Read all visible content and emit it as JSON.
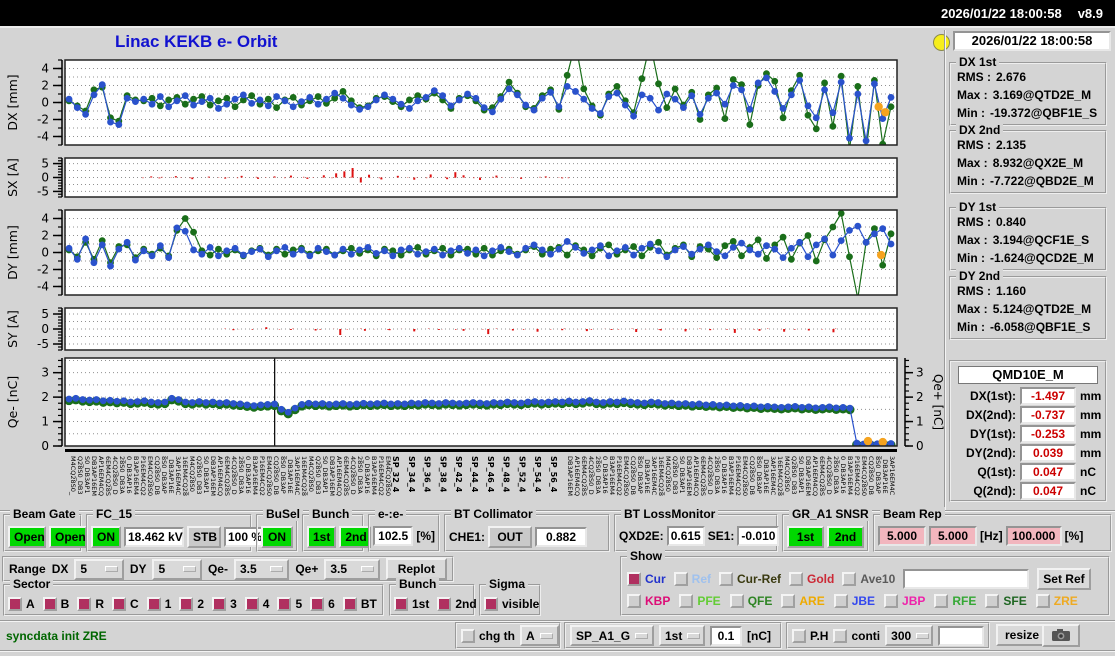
{
  "topbar": {
    "datetime": "2026/01/22 18:00:58",
    "version": "v8.9"
  },
  "header": {
    "title": "Linac KEKB e- Orbit",
    "clock": "2026/01/22 18:00:58"
  },
  "stats": [
    {
      "title": "DX 1st",
      "lines": [
        {
          "label": "RMS :",
          "value": "2.676"
        },
        {
          "label": "Max :",
          "value": "3.169@QTD2E_M"
        },
        {
          "label": "Min :",
          "value": "-19.372@QBF1E_S"
        }
      ]
    },
    {
      "title": "DX 2nd",
      "lines": [
        {
          "label": "RMS :",
          "value": "2.135"
        },
        {
          "label": "Max :",
          "value": "8.932@QX2E_M"
        },
        {
          "label": "Min :",
          "value": "-7.722@QBD2E_M"
        }
      ]
    },
    {
      "title": "DY 1st",
      "lines": [
        {
          "label": "RMS :",
          "value": "0.840"
        },
        {
          "label": "Max :",
          "value": "3.194@QCF1E_S"
        },
        {
          "label": "Min :",
          "value": "-1.624@QCD2E_M"
        }
      ]
    },
    {
      "title": "DY 2nd",
      "lines": [
        {
          "label": "RMS :",
          "value": "1.160"
        },
        {
          "label": "Max :",
          "value": "5.124@QTD2E_M"
        },
        {
          "label": "Min :",
          "value": "-6.058@QBF1E_S"
        }
      ]
    }
  ],
  "qmd": {
    "title": "QMD10E_M",
    "rows": [
      {
        "label": "DX(1st):",
        "value": "-1.497",
        "unit": "mm"
      },
      {
        "label": "DX(2nd):",
        "value": "-0.737",
        "unit": "mm"
      },
      {
        "label": "DY(1st):",
        "value": "-0.253",
        "unit": "mm"
      },
      {
        "label": "DY(2nd):",
        "value": "0.039",
        "unit": "mm"
      },
      {
        "label": "Q(1st):",
        "value": "0.047",
        "unit": "nC"
      },
      {
        "label": "Q(2nd):",
        "value": "0.047",
        "unit": "nC"
      }
    ]
  },
  "controls": {
    "beam_gate": {
      "title": "Beam Gate",
      "b1": "Open",
      "b2": "Open"
    },
    "fc15": {
      "title": "FC_15",
      "on": "ON",
      "kv": "18.462 kV",
      "stb": "STB",
      "pct": "100 %"
    },
    "busel": {
      "title": "BuSel",
      "on": "ON"
    },
    "bunch": {
      "title": "Bunch",
      "b1": "1st",
      "b2": "2nd"
    },
    "ee": {
      "title": "e-:e-",
      "value": "102.5",
      "unit": "[%]"
    },
    "bt_collimator": {
      "title": "BT Collimator",
      "che1_label": "CHE1:",
      "che1": "OUT",
      "value": "0.882"
    },
    "bt_loss": {
      "title": "BT LossMonitor",
      "qxd2e_label": "QXD2E:",
      "qxd2e": "0.615",
      "se1_label": "SE1:",
      "se1": "-0.010"
    },
    "gr_snsr": {
      "title": "GR_A1 SNSR",
      "b1": "1st",
      "b2": "2nd"
    },
    "beam_rep": {
      "title": "Beam Rep",
      "v1": "5.000",
      "v2": "5.000",
      "hz": "[Hz]",
      "v3": "100.000",
      "pct": "[%]"
    }
  },
  "range_row": {
    "label": "Range",
    "dx_label": "DX",
    "dx": "5",
    "dy_label": "DY",
    "dy": "5",
    "qem_label": "Qe-",
    "qem": "3.5",
    "qep_label": "Qe+",
    "qep": "3.5",
    "replot": "Replot"
  },
  "sector": {
    "title": "Sector",
    "items": [
      {
        "label": "A",
        "checked": true
      },
      {
        "label": "B",
        "checked": true
      },
      {
        "label": "R",
        "checked": true
      },
      {
        "label": "C",
        "checked": true
      },
      {
        "label": "1",
        "checked": true
      },
      {
        "label": "2",
        "checked": true
      },
      {
        "label": "3",
        "checked": true
      },
      {
        "label": "4",
        "checked": true
      },
      {
        "label": "5",
        "checked": true
      },
      {
        "label": "6",
        "checked": true
      },
      {
        "label": "BT",
        "checked": true
      }
    ]
  },
  "bunch2": {
    "title": "Bunch",
    "items": [
      {
        "label": "1st",
        "checked": true
      },
      {
        "label": "2nd",
        "checked": true
      }
    ]
  },
  "sigma": {
    "title": "Sigma",
    "item": {
      "label": "visible",
      "checked": true
    }
  },
  "show": {
    "title": "Show",
    "row1": [
      {
        "label": "Cur",
        "color": "#2233cc",
        "checked": true
      },
      {
        "label": "Ref",
        "color": "#9fc1ee",
        "checked": false
      },
      {
        "label": "Cur-Ref",
        "color": "#3a3a10",
        "checked": false
      },
      {
        "label": "Gold",
        "color": "#cc2936",
        "checked": false
      },
      {
        "label": "Ave10",
        "color": "#5a5a5a",
        "checked": false
      }
    ],
    "input_value": "",
    "set_ref": "Set Ref",
    "row2": [
      {
        "label": "KBP",
        "color": "#dd0d77",
        "checked": false
      },
      {
        "label": "PFE",
        "color": "#63cc35",
        "checked": false
      },
      {
        "label": "QFE",
        "color": "#2e8424",
        "checked": false
      },
      {
        "label": "ARE",
        "color": "#eeaa00",
        "checked": false
      },
      {
        "label": "JBE",
        "color": "#3347ee",
        "checked": false
      },
      {
        "label": "JBP",
        "color": "#ee22aa",
        "checked": false
      },
      {
        "label": "RFE",
        "color": "#35a835",
        "checked": false
      },
      {
        "label": "SFE",
        "color": "#1f6622",
        "checked": false
      },
      {
        "label": "ZRE",
        "color": "#eeaa22",
        "checked": false
      }
    ]
  },
  "statusbar": {
    "message": "syncdata init ZRE",
    "chg_th": {
      "label": "chg th",
      "checked": false
    },
    "sel_a": "A",
    "sp": "SP_A1_G",
    "first": "1st",
    "thr": "0.1",
    "nc": "[nC]",
    "ph": {
      "label": "P.H",
      "checked": false
    },
    "conti": {
      "label": "conti",
      "checked": false
    },
    "n300": "300",
    "free_input": "",
    "resize": "resize"
  },
  "colors": {
    "accent_blue": "#2a52cc",
    "accent_green": "#1a6e1a",
    "accent_orange": "#f5a31f",
    "bar_red": "#dd1111",
    "on_green": "#00d800",
    "pink": "#f2b6be",
    "check_maroon": "#b03060",
    "value_red": "#cc0000",
    "title_blue": "#1212d0"
  },
  "plots": {
    "dx": {
      "label": "DX [mm]",
      "ticks": [
        4,
        2,
        0,
        -2,
        -4
      ],
      "blue": [
        0.4,
        -0.6,
        -1.4,
        0.9,
        2.1,
        -2.3,
        -2.6,
        0.5,
        0.1,
        0.4,
        -0.2,
        0.7,
        -0.5,
        0.2,
        0.8,
        -0.3,
        0.1,
        0.5,
        -0.7,
        -0.2,
        0.4,
        0.9,
        -0.1,
        0.3,
        -0.4,
        0.7,
        0.2,
        -0.5,
        0.1,
        0.6,
        -0.2,
        0.4,
        1.1,
        0.5,
        -0.3,
        -0.8,
        -0.5,
        0.3,
        0.9,
        0.4,
        -0.2,
        -0.7,
        0.2,
        0.6,
        1.4,
        0.8,
        -0.4,
        0.3,
        1.0,
        0.5,
        -0.6,
        -1.1,
        0.4,
        1.6,
        0.9,
        -0.3,
        -0.9,
        0.5,
        1.2,
        -0.5,
        1.9,
        1.3,
        0.4,
        -0.7,
        -1.3,
        0.7,
        1.1,
        -0.3,
        -1.6,
        0.9,
        0.5,
        -0.9,
        1.0,
        0.4,
        -0.6,
        0.8,
        -1.4,
        0.5,
        1.1,
        -0.2,
        2.0,
        1.5,
        -0.8,
        2.3,
        2.9,
        1.3,
        -0.7,
        0.9,
        2.6,
        -0.4,
        -1.8,
        1.5,
        -1.2,
        2.4,
        -4.2,
        1.0,
        -4.5,
        2.2,
        -1.9,
        0.6
      ],
      "green": [
        0.2,
        -0.4,
        -1.0,
        1.5,
        1.8,
        -1.8,
        -2.2,
        0.8,
        0.3,
        0.2,
        0.5,
        -0.4,
        0.3,
        0.6,
        -0.2,
        0.4,
        0.7,
        -0.3,
        0.2,
        0.5,
        -0.5,
        0.3,
        0.8,
        -0.2,
        0.4,
        -0.6,
        0.3,
        0.6,
        -0.3,
        0.2,
        0.7,
        -0.1,
        0.5,
        1.3,
        0.2,
        -0.6,
        -0.4,
        0.5,
        0.7,
        0.1,
        -0.5,
        0.3,
        0.8,
        0.4,
        1.1,
        0.3,
        -0.7,
        0.5,
        0.8,
        0.2,
        -0.9,
        -0.6,
        0.7,
        2.4,
        1.1,
        -0.5,
        -0.7,
        0.8,
        1.5,
        -0.8,
        3.2,
        8.5,
        1.6,
        -0.4,
        -1.5,
        1.0,
        1.9,
        0.2,
        -1.2,
        2.8,
        8.8,
        2.2,
        -0.6,
        1.6,
        -0.3,
        1.2,
        -2.0,
        0.9,
        1.7,
        -1.9,
        2.7,
        2.1,
        -2.6,
        2.0,
        3.4,
        2.5,
        -1.8,
        1.4,
        3.2,
        -1.5,
        -3.1,
        2.3,
        -2.8,
        3.1,
        -5.5,
        1.9,
        -5.8,
        2.6,
        -4.9,
        -0.5
      ],
      "orange": [
        [
          0.985,
          -0.5
        ],
        [
          0.993,
          -1.15
        ]
      ]
    },
    "sx": {
      "label": "SX [A]",
      "ticks": [
        5,
        0,
        -5
      ],
      "bars": [
        [
          0.1,
          0.4
        ],
        [
          0.11,
          -0.3
        ],
        [
          0.13,
          0.5
        ],
        [
          0.15,
          -0.6
        ],
        [
          0.17,
          0.3
        ],
        [
          0.19,
          -0.4
        ],
        [
          0.21,
          0.6
        ],
        [
          0.23,
          -0.5
        ],
        [
          0.25,
          0.4
        ],
        [
          0.27,
          0.7
        ],
        [
          0.29,
          -0.5
        ],
        [
          0.31,
          0.8
        ],
        [
          0.325,
          1.5
        ],
        [
          0.335,
          2.2
        ],
        [
          0.345,
          3.4
        ],
        [
          0.355,
          -1.8
        ],
        [
          0.365,
          1.0
        ],
        [
          0.38,
          -0.7
        ],
        [
          0.4,
          0.6
        ],
        [
          0.42,
          -0.8
        ],
        [
          0.44,
          1.1
        ],
        [
          0.46,
          -0.6
        ],
        [
          0.47,
          1.9
        ],
        [
          0.48,
          0.8
        ],
        [
          0.5,
          -0.9
        ],
        [
          0.52,
          0.7
        ],
        [
          0.55,
          -0.5
        ],
        [
          0.58,
          0.4
        ],
        [
          0.6,
          -0.3
        ]
      ]
    },
    "dy": {
      "label": "DY [mm]",
      "ticks": [
        4,
        2,
        0,
        -2,
        -4
      ],
      "blue": [
        0.5,
        -0.8,
        1.6,
        -1.2,
        0.9,
        -1.6,
        0.4,
        1.2,
        -0.9,
        0.2,
        -0.4,
        0.8,
        -0.6,
        2.9,
        2.5,
        0.3,
        -0.2,
        0.6,
        -0.4,
        0.2,
        0.5,
        -0.3,
        0.1,
        0.4,
        -0.5,
        0.2,
        0.6,
        -0.2,
        0.3,
        -0.4,
        0.5,
        0.1,
        -0.3,
        0.4,
        -0.2,
        0.3,
        0.6,
        -0.1,
        0.2,
        -0.4,
        0.3,
        0.5,
        -0.2,
        0.1,
        0.4,
        -0.3,
        0.2,
        0.5,
        -0.1,
        0.3,
        -0.4,
        0.2,
        0.6,
        0.1,
        -0.3,
        0.5,
        0.9,
        0.3,
        -0.2,
        0.4,
        1.3,
        0.6,
        -0.1,
        0.3,
        0.8,
        -0.4,
        0.2,
        0.6,
        -0.3,
        0.5,
        1.0,
        0.2,
        -0.5,
        0.3,
        0.7,
        -0.2,
        0.4,
        0.9,
        0.1,
        -0.4,
        0.6,
        1.1,
        0.3,
        -0.2,
        0.8,
        0.4,
        -0.6,
        0.5,
        1.2,
        -0.5,
        0.9,
        1.6,
        -0.3,
        1.4,
        2.6,
        3.1,
        1.2,
        2.2,
        2.8,
        1.0
      ],
      "green": [
        0.3,
        -0.5,
        1.2,
        -0.8,
        1.4,
        -1.2,
        0.7,
        0.9,
        -0.6,
        0.4,
        -0.2,
        0.5,
        -0.4,
        2.6,
        4.0,
        2.4,
        0.2,
        -0.3,
        0.4,
        -0.2,
        0.3,
        -0.4,
        0.2,
        0.5,
        -0.3,
        0.4,
        -0.2,
        0.3,
        0.5,
        -0.2,
        0.2,
        0.4,
        -0.3,
        0.2,
        0.5,
        -0.1,
        0.3,
        -0.4,
        0.4,
        0.2,
        -0.3,
        0.3,
        0.6,
        -0.2,
        0.2,
        0.5,
        -0.3,
        0.3,
        0.4,
        -0.2,
        0.5,
        -0.3,
        0.2,
        0.4,
        -0.2,
        0.3,
        0.7,
        -0.2,
        0.4,
        0.6,
        -0.3,
        0.8,
        0.3,
        -0.4,
        0.5,
        0.9,
        -0.2,
        0.3,
        0.7,
        -0.4,
        0.6,
        1.2,
        -0.3,
        0.5,
        0.9,
        -0.5,
        0.7,
        0.4,
        -0.6,
        0.8,
        1.3,
        -0.4,
        0.6,
        1.5,
        -0.7,
        0.9,
        1.8,
        -0.8,
        1.1,
        2.0,
        -1.0,
        1.5,
        3.0,
        4.6,
        -0.5,
        -5.4,
        1.2,
        2.8,
        -1.5,
        2.2
      ],
      "orange": [
        [
          0.988,
          -0.3
        ]
      ]
    },
    "sy": {
      "label": "SY [A]",
      "ticks": [
        5,
        0,
        -5
      ],
      "bars": [
        [
          0.2,
          -0.4
        ],
        [
          0.24,
          0.6
        ],
        [
          0.27,
          -0.3
        ],
        [
          0.3,
          -0.5
        ],
        [
          0.33,
          -2.0
        ],
        [
          0.36,
          -0.6
        ],
        [
          0.39,
          -0.4
        ],
        [
          0.42,
          -0.8
        ],
        [
          0.45,
          -0.3
        ],
        [
          0.48,
          -0.6
        ],
        [
          0.51,
          -1.7
        ],
        [
          0.54,
          -0.5
        ],
        [
          0.57,
          -0.9
        ],
        [
          0.6,
          -0.4
        ],
        [
          0.63,
          -0.7
        ],
        [
          0.66,
          -0.3
        ],
        [
          0.69,
          -1.0
        ],
        [
          0.72,
          -0.5
        ],
        [
          0.75,
          -0.8
        ],
        [
          0.78,
          -0.4
        ],
        [
          0.81,
          -1.3
        ],
        [
          0.84,
          -0.6
        ],
        [
          0.87,
          -0.9
        ],
        [
          0.9,
          -0.5
        ],
        [
          0.93,
          -1.1
        ]
      ]
    },
    "qe": {
      "label": "Qe- [nC]",
      "right_label": "Qe+ [nC]",
      "ticks": [
        3,
        2,
        1,
        0
      ],
      "marker_x": 0.252,
      "blue": [
        1.92,
        1.95,
        1.9,
        1.88,
        1.9,
        1.85,
        1.87,
        1.83,
        1.85,
        1.8,
        1.82,
        1.85,
        1.8,
        1.78,
        1.8,
        1.95,
        1.9,
        1.8,
        1.78,
        1.82,
        1.78,
        1.8,
        1.76,
        1.78,
        1.74,
        1.72,
        1.68,
        1.65,
        1.68,
        1.7,
        1.72,
        1.5,
        1.38,
        1.55,
        1.7,
        1.75,
        1.72,
        1.74,
        1.7,
        1.72,
        1.74,
        1.7,
        1.72,
        1.75,
        1.72,
        1.74,
        1.76,
        1.72,
        1.74,
        1.72,
        1.76,
        1.74,
        1.78,
        1.76,
        1.74,
        1.78,
        1.76,
        1.74,
        1.76,
        1.78,
        1.76,
        1.74,
        1.78,
        1.76,
        1.8,
        1.78,
        1.76,
        1.8,
        1.82,
        1.78,
        1.8,
        1.82,
        1.8,
        1.84,
        1.8,
        1.82,
        1.86,
        1.8,
        1.78,
        1.82,
        1.8,
        1.84,
        1.8,
        1.78,
        1.76,
        1.8,
        1.78,
        1.74,
        1.76,
        1.72,
        1.74,
        1.7,
        1.72,
        1.68,
        1.7,
        1.66,
        1.68,
        1.64,
        1.66,
        1.62,
        1.64,
        1.6,
        1.62,
        1.6,
        1.58,
        1.6,
        1.62,
        1.58,
        1.6,
        1.56,
        1.58,
        1.6,
        1.56,
        1.58,
        1.55,
        0.12,
        0.08,
        0.1,
        0.09,
        0.11,
        0.1
      ],
      "orange": [
        [
          0.972,
          0.2
        ],
        [
          0.99,
          0.16
        ]
      ]
    },
    "xaxis": {
      "legible": [
        "SP_32_4",
        "SP_34_4",
        "SP_36_4",
        "SP_38_4",
        "SP_42_4",
        "SP_44_4",
        "SP_46_4",
        "SP_48_4",
        "SP_52_4",
        "SP_54_4",
        "SP_56_4"
      ],
      "glyphs": "SPQBM01234_68ACDE"
    }
  }
}
